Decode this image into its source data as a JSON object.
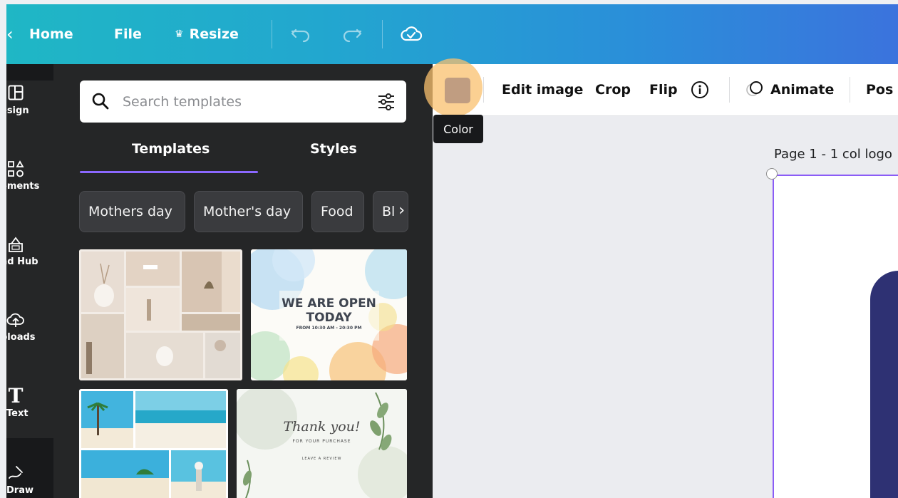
{
  "topbar": {
    "home_label": "Home",
    "file_label": "File",
    "resize_label": "Resize"
  },
  "rail": {
    "items": [
      {
        "label": "esign",
        "icon": "layout-icon"
      },
      {
        "label": "ements",
        "icon": "shapes-icon"
      },
      {
        "label": "nd Hub",
        "icon": "brand-icon"
      },
      {
        "label": "ploads",
        "icon": "upload-cloud-icon"
      },
      {
        "label": "Text",
        "icon": "text-icon"
      },
      {
        "label": "Draw",
        "icon": "draw-icon"
      }
    ]
  },
  "panel": {
    "search_placeholder": "Search templates",
    "tabs": [
      {
        "label": "Templates"
      },
      {
        "label": "Styles"
      }
    ],
    "chips": [
      {
        "label": "Mothers day"
      },
      {
        "label": "Mother's day"
      },
      {
        "label": "Food"
      },
      {
        "label": "Bl"
      }
    ],
    "templates": [
      {
        "kind": "collage",
        "text": ""
      },
      {
        "kind": "open-sign",
        "line1": "WE ARE OPEN",
        "line2": "TODAY",
        "line3": "FROM 10:30 AM - 20:30 PM"
      },
      {
        "kind": "beach",
        "text": ""
      },
      {
        "kind": "thank-you",
        "line1": "Thank you!",
        "line2": "FOR YOUR PURCHASE",
        "line3": "LEAVE A REVIEW"
      }
    ]
  },
  "context_toolbar": {
    "color_tooltip": "Color",
    "swatch_color": "#c09d81",
    "edit_image_label": "Edit image",
    "crop_label": "Crop",
    "flip_label": "Flip",
    "animate_label": "Animate",
    "position_label": "Pos"
  },
  "canvas": {
    "page_label": "Page 1 - 1 col logo",
    "accent_color": "#8b5cf6"
  }
}
